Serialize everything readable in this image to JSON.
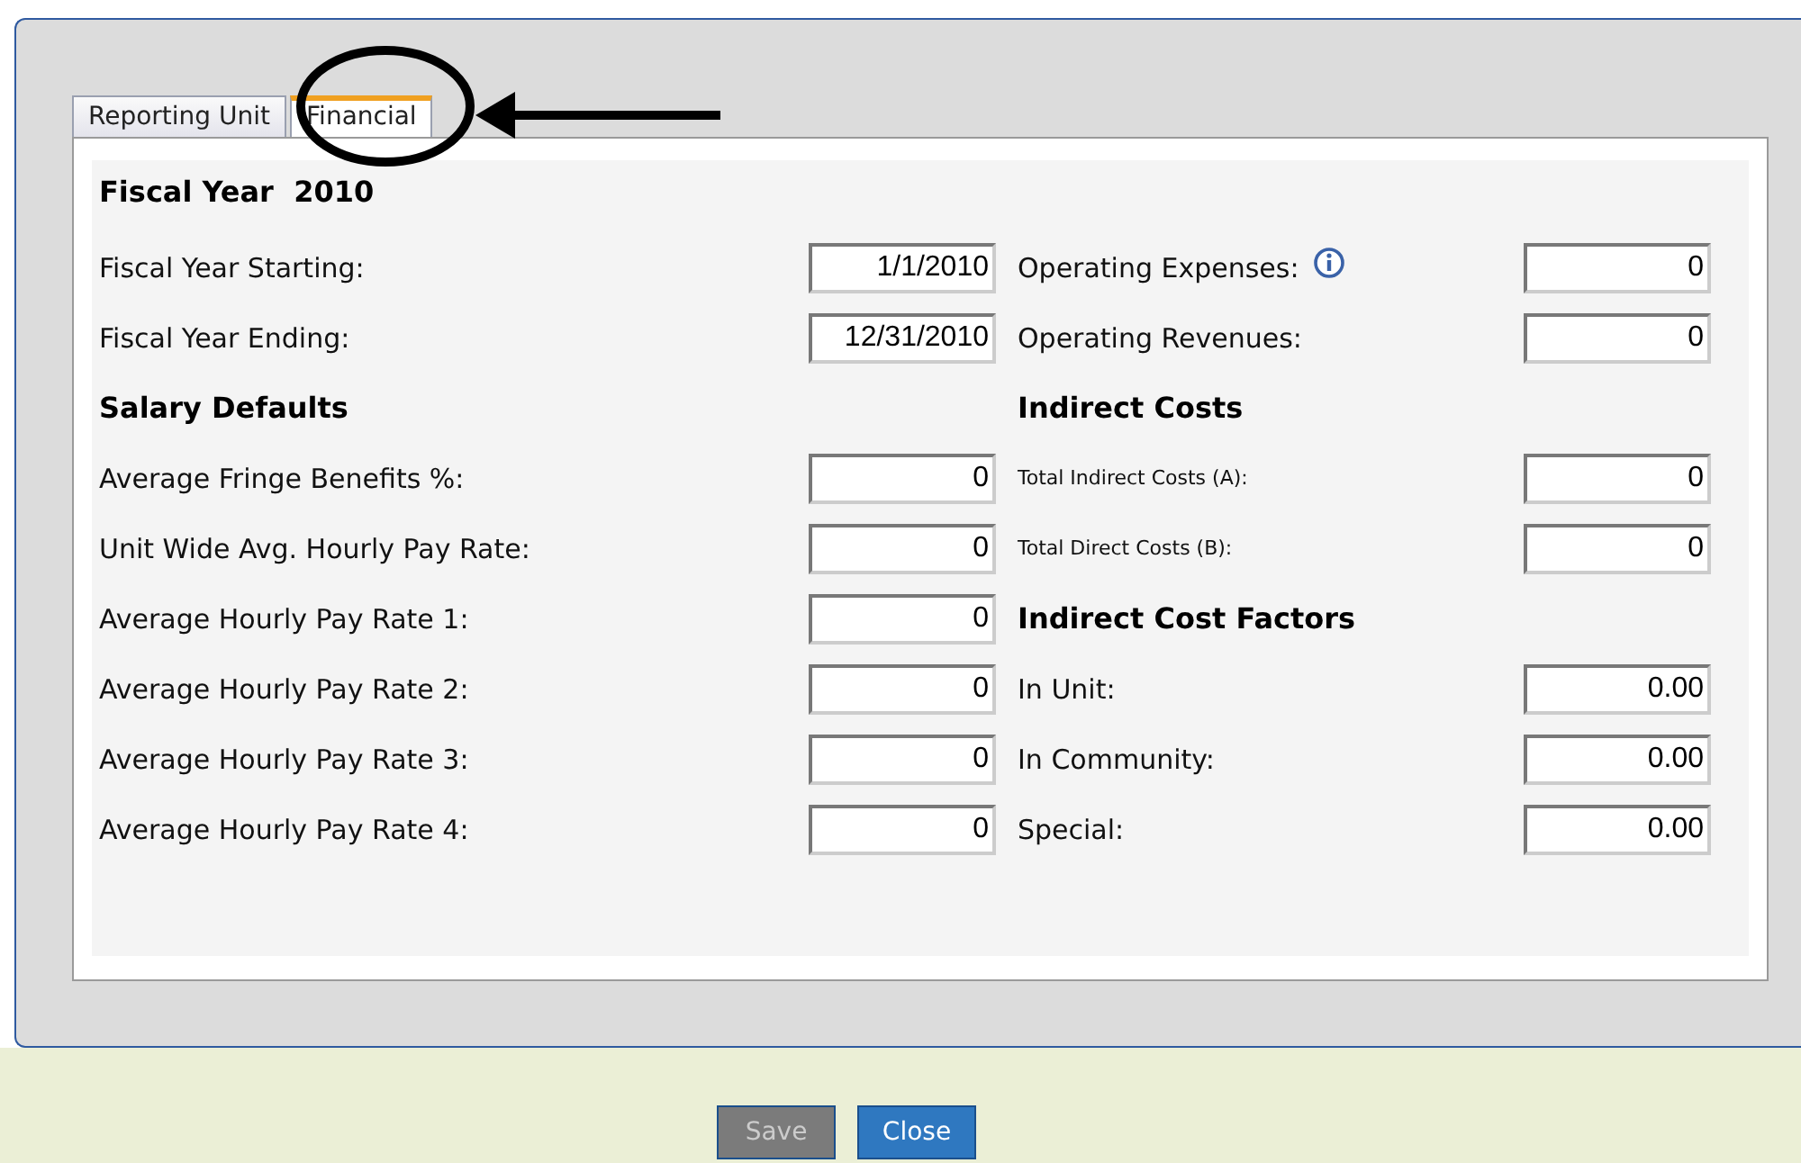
{
  "tabs": [
    {
      "label": "Reporting Unit",
      "selected": false
    },
    {
      "label": "Financial",
      "selected": true
    }
  ],
  "title": "Fiscal Year  2010",
  "rows": [
    {
      "left": {
        "kind": "field",
        "label": "Fiscal Year Starting:",
        "value": "1/1/2010"
      },
      "right": {
        "kind": "field",
        "label": "Operating Expenses:",
        "info": true,
        "value": "0"
      }
    },
    {
      "left": {
        "kind": "field",
        "label": "Fiscal Year Ending:",
        "value": "12/31/2010"
      },
      "right": {
        "kind": "field",
        "label": "Operating Revenues:",
        "value": "0"
      }
    },
    {
      "left": {
        "kind": "heading",
        "label": "Salary Defaults"
      },
      "right": {
        "kind": "heading",
        "label": "Indirect Costs"
      }
    },
    {
      "left": {
        "kind": "field",
        "label": "Average Fringe Benefits %:",
        "value": "0"
      },
      "right": {
        "kind": "small",
        "label": "Total Indirect Costs (A):",
        "value": "0"
      }
    },
    {
      "left": {
        "kind": "field",
        "label": "Unit Wide Avg. Hourly Pay Rate:",
        "value": "0"
      },
      "right": {
        "kind": "small",
        "label": "Total Direct Costs (B):",
        "value": "0"
      }
    },
    {
      "left": {
        "kind": "field",
        "label": "Average Hourly Pay Rate 1:",
        "value": "0"
      },
      "right": {
        "kind": "heading",
        "label": "Indirect Cost Factors"
      }
    },
    {
      "left": {
        "kind": "field",
        "label": "Average Hourly Pay Rate 2:",
        "value": "0"
      },
      "right": {
        "kind": "field",
        "label": "In Unit:",
        "value": "0.00"
      }
    },
    {
      "left": {
        "kind": "field",
        "label": "Average Hourly Pay Rate 3:",
        "value": "0"
      },
      "right": {
        "kind": "field",
        "label": "In Community:",
        "value": "0.00"
      }
    },
    {
      "left": {
        "kind": "field",
        "label": "Average Hourly Pay Rate 4:",
        "value": "0"
      },
      "right": {
        "kind": "field",
        "label": "Special:",
        "value": "0.00"
      }
    }
  ],
  "buttons": [
    {
      "label": "Save",
      "disabled": true
    },
    {
      "label": "Close",
      "disabled": false
    }
  ]
}
